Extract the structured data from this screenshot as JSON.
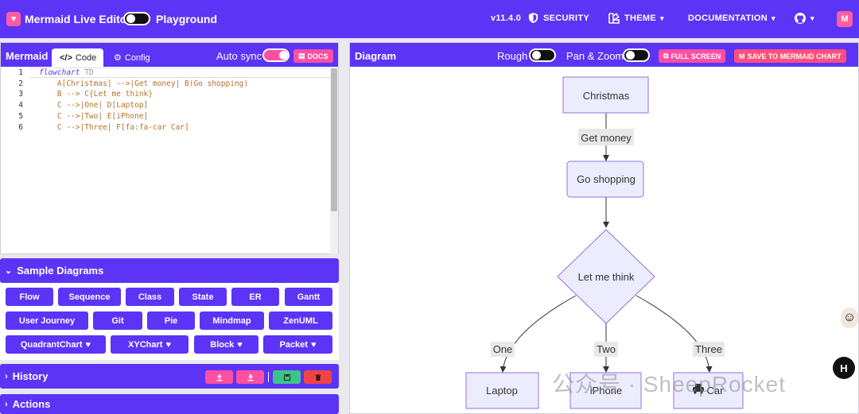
{
  "header": {
    "app_title": "Mermaid Live Editor",
    "playground_label": "Playground",
    "version": "v11.4.0",
    "security_label": "SECURITY",
    "theme_label": "THEME",
    "documentation_label": "DOCUMENTATION",
    "playground_toggle_on": false
  },
  "editor": {
    "panel_title": "Mermaid",
    "tab_code": "Code",
    "tab_config": "Config",
    "autosync_label": "Auto sync",
    "autosync_on": true,
    "docs_label": "DOCS",
    "lines": [
      {
        "num": "1",
        "keyword": "flowchart",
        "rest": " TD"
      },
      {
        "num": "2",
        "keyword": "",
        "rest": "    A[Christmas] -->|Get money| B(Go shopping)"
      },
      {
        "num": "3",
        "keyword": "",
        "rest": "    B --> C{Let me think}"
      },
      {
        "num": "4",
        "keyword": "",
        "rest": "    C -->|One| D[Laptop]"
      },
      {
        "num": "5",
        "keyword": "",
        "rest": "    C -->|Two| E[iPhone]"
      },
      {
        "num": "6",
        "keyword": "",
        "rest": "    C -->|Three| F[fa:fa-car Car]"
      }
    ]
  },
  "samples": {
    "title": "Sample Diagrams",
    "buttons": [
      "Flow",
      "Sequence",
      "Class",
      "State",
      "ER",
      "Gantt",
      "User Journey",
      "Git",
      "Pie",
      "Mindmap",
      "ZenUML",
      "QuadrantChart",
      "XYChart",
      "Block",
      "Packet"
    ]
  },
  "history": {
    "title": "History"
  },
  "actions": {
    "title": "Actions"
  },
  "diagram": {
    "panel_title": "Diagram",
    "rough_label": "Rough",
    "panzoom_label": "Pan & Zoom",
    "fullscreen_label": "FULL SCREEN",
    "save_label": "SAVE TO MERMAID CHART",
    "nodes": {
      "a": "Christmas",
      "b": "Go shopping",
      "c": "Let me think",
      "d": "Laptop",
      "e": "iPhone",
      "f": "Car"
    },
    "edges": {
      "ab": "Get money",
      "cd": "One",
      "ce": "Two",
      "cf": "Three"
    }
  },
  "watermark": "公众号 · SheepRocket",
  "colors": {
    "brand": "#5b34f5",
    "accent": "#ff4fa0",
    "node_fill": "#ececff",
    "node_stroke": "#9370db"
  }
}
